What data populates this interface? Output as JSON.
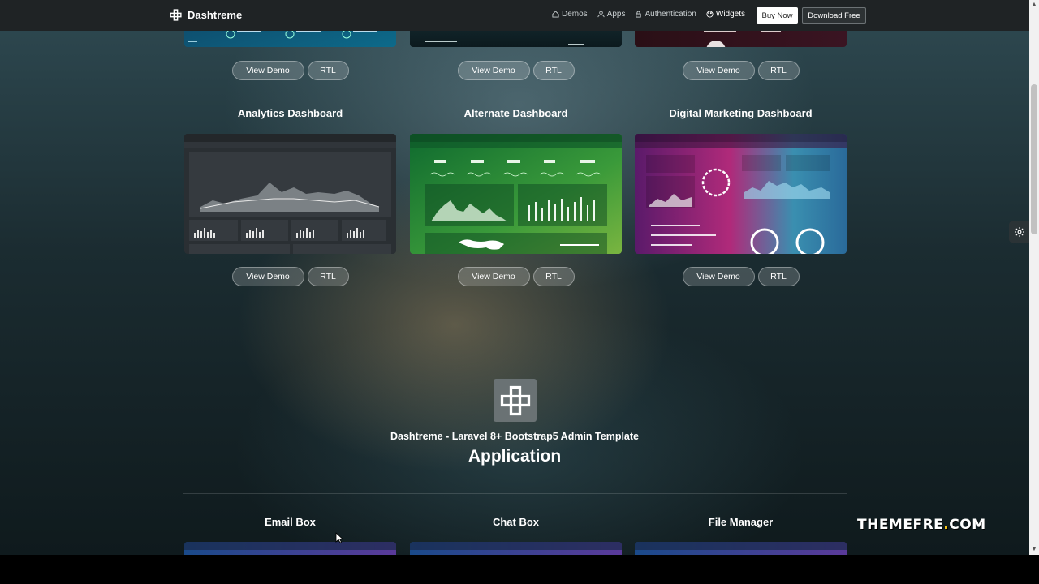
{
  "navbar": {
    "brand": "Dashtreme",
    "links": [
      {
        "label": "Demos",
        "icon": "home-icon"
      },
      {
        "label": "Apps",
        "icon": "user-icon"
      },
      {
        "label": "Authentication",
        "icon": "lock-icon"
      },
      {
        "label": "Widgets",
        "icon": "palette-icon"
      }
    ],
    "buy_label": "Buy Now",
    "download_label": "Download Free"
  },
  "top_row": [
    {
      "demo_label": "View Demo",
      "rtl_label": "RTL"
    },
    {
      "demo_label": "View Demo",
      "rtl_label": "RTL"
    },
    {
      "demo_label": "View Demo",
      "rtl_label": "RTL"
    }
  ],
  "dashboards": [
    {
      "title": "Analytics Dashboard",
      "demo_label": "View Demo",
      "rtl_label": "RTL"
    },
    {
      "title": "Alternate Dashboard",
      "demo_label": "View Demo",
      "rtl_label": "RTL"
    },
    {
      "title": "Digital Marketing Dashboard",
      "demo_label": "View Demo",
      "rtl_label": "RTL"
    }
  ],
  "application": {
    "tagline": "Dashtreme - Laravel 8+ Bootstrap5 Admin Template",
    "heading": "Application",
    "apps": [
      {
        "title": "Email Box"
      },
      {
        "title": "Chat Box"
      },
      {
        "title": "File Manager"
      }
    ]
  },
  "watermark": {
    "main": "THEMEFRE",
    "dot": ".",
    "tld": "COM"
  }
}
